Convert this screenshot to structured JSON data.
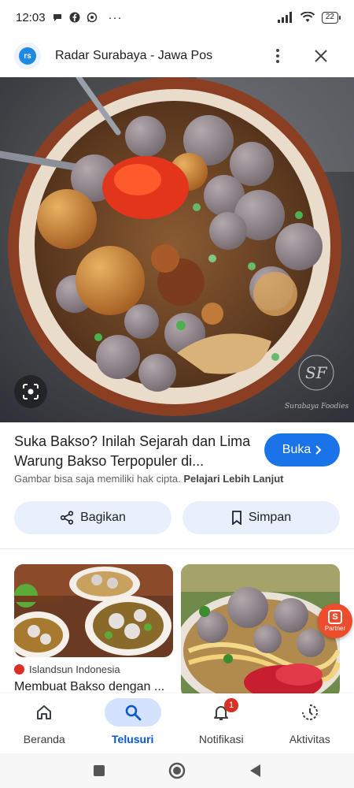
{
  "status_bar": {
    "time": "12:03",
    "battery": "22",
    "dots": "···"
  },
  "header": {
    "logo_text": "rs",
    "site_title": "Radar Surabaya - Jawa Pos"
  },
  "image": {
    "watermark": "SF",
    "watermark_caption": "Surabaya Foodies"
  },
  "article": {
    "title": "Suka Bakso? Inilah Sejarah dan Lima Warung Bakso Terpopuler di...",
    "open_label": "Buka",
    "copyright_text": "Gambar bisa saja memiliki hak cipta.",
    "copyright_link": "Pelajari Lebih Lanjut"
  },
  "actions": {
    "share_label": "Bagikan",
    "save_label": "Simpan"
  },
  "related": [
    {
      "source": "Islandsun Indonesia",
      "text": "Membuat Bakso dengan ..."
    },
    {
      "source": "",
      "text": ""
    }
  ],
  "partner": {
    "badge_letter": "S",
    "label": "Partner"
  },
  "bottom_nav": {
    "items": [
      {
        "label": "Beranda",
        "icon": "home-icon"
      },
      {
        "label": "Telusuri",
        "icon": "search-icon",
        "active": true
      },
      {
        "label": "Notifikasi",
        "icon": "bell-icon",
        "badge": "1"
      },
      {
        "label": "Aktivitas",
        "icon": "activity-icon"
      }
    ]
  },
  "colors": {
    "accent": "#1a73e8",
    "active_pill": "#d3e3fd",
    "chip_bg": "#e8f0fe",
    "badge": "#d93025",
    "partner": "#ee4d2d"
  }
}
